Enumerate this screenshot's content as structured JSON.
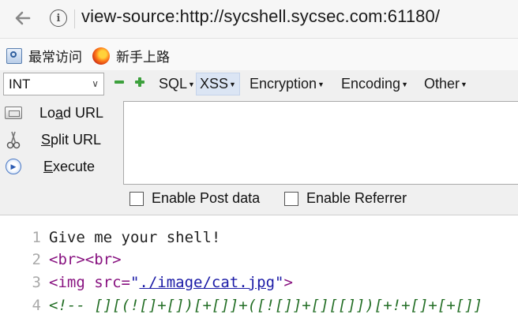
{
  "address_bar": {
    "url": "view-source:http://sycshell.sycsec.com:61180/"
  },
  "bookmarks": [
    {
      "label": "最常访问",
      "icon": "most-visited-icon"
    },
    {
      "label": "新手上路",
      "icon": "firefox-icon"
    }
  ],
  "hackbar": {
    "select_value": "INT",
    "menus": [
      {
        "label": "SQL",
        "active": false
      },
      {
        "label": "XSS",
        "active": true
      },
      {
        "label": "Encryption",
        "active": false
      },
      {
        "label": "Encoding",
        "active": false
      },
      {
        "label": "Other",
        "active": false
      }
    ],
    "actions": {
      "load": {
        "pre": "Lo",
        "key": "a",
        "post": "d URL"
      },
      "split": {
        "pre": "",
        "key": "S",
        "post": "plit URL"
      },
      "execute": {
        "pre": "",
        "key": "E",
        "post": "xecute"
      }
    },
    "url_value": "",
    "checkboxes": [
      {
        "label": "Enable Post data",
        "checked": false
      },
      {
        "label": "Enable Referrer",
        "checked": false
      }
    ]
  },
  "source": {
    "line_numbers": [
      "1",
      "2",
      "3",
      "4"
    ],
    "line1": "Give me your shell!",
    "line2_tags": [
      "<br>",
      "<br>"
    ],
    "line3": {
      "open": "<img",
      "attr": " src=",
      "quote_open": "\"",
      "value": "./image/cat.jpg",
      "quote_close": "\"",
      "close": ">"
    },
    "line4": "<!-- [][(![]+[])[+[]]+([![]]+[][[]])[+!+[]+[+[]]"
  },
  "colors": {
    "accent_active_menu": "#dbe5f4",
    "tag": "#881280",
    "comment": "#236e25",
    "link": "#1a1aa6"
  }
}
